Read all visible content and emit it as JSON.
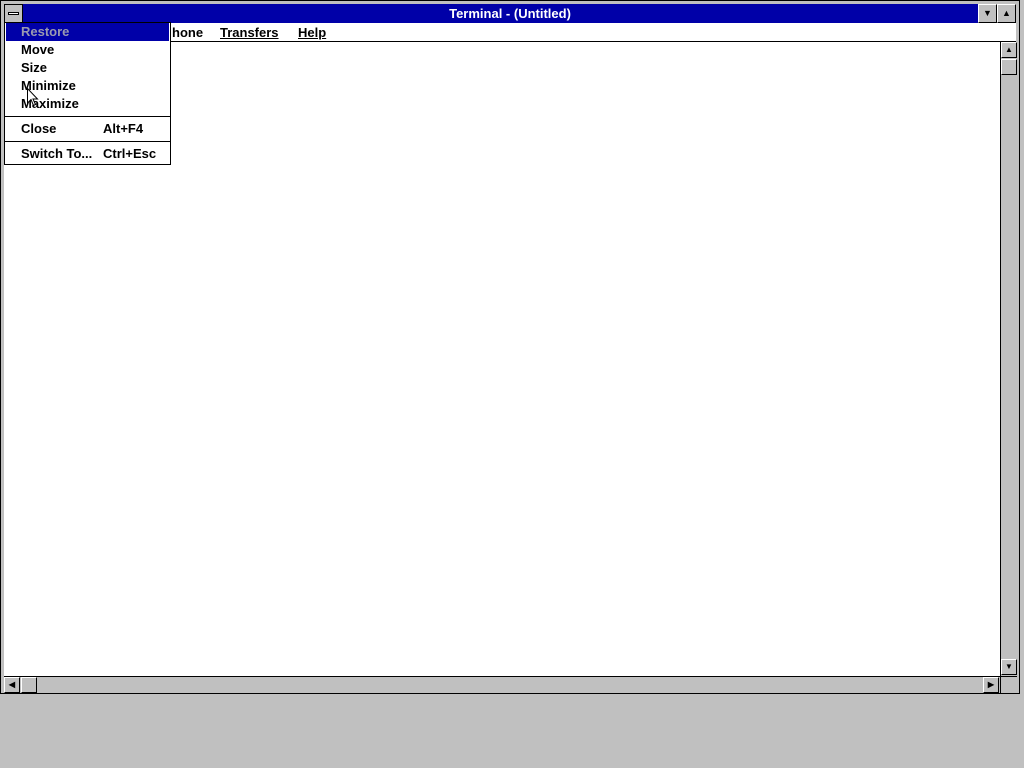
{
  "window": {
    "title": "Terminal - (Untitled)"
  },
  "titlebar_buttons": {
    "minimize_glyph": "▼",
    "maximize_glyph": "▲"
  },
  "menubar": {
    "items": [
      {
        "label": "hone"
      },
      {
        "label": "Transfers"
      },
      {
        "label": "Help"
      }
    ]
  },
  "system_menu": {
    "items": [
      {
        "label": "Restore",
        "shortcut": "",
        "state": "disabled-highlighted"
      },
      {
        "label": "Move",
        "shortcut": ""
      },
      {
        "label": "Size",
        "shortcut": ""
      },
      {
        "label": "Minimize",
        "shortcut": ""
      },
      {
        "label": "Maximize",
        "shortcut": ""
      },
      {
        "label": "Close",
        "shortcut": "Alt+F4"
      },
      {
        "label": "Switch To...",
        "shortcut": "Ctrl+Esc"
      }
    ]
  },
  "scrollbars": {
    "up": "▲",
    "down": "▼",
    "left": "◀",
    "right": "▶"
  },
  "colors": {
    "titlebar": "#0000a8",
    "desktop": "#c0c0c0",
    "client": "#ffffff",
    "highlight": "#0000a8"
  }
}
